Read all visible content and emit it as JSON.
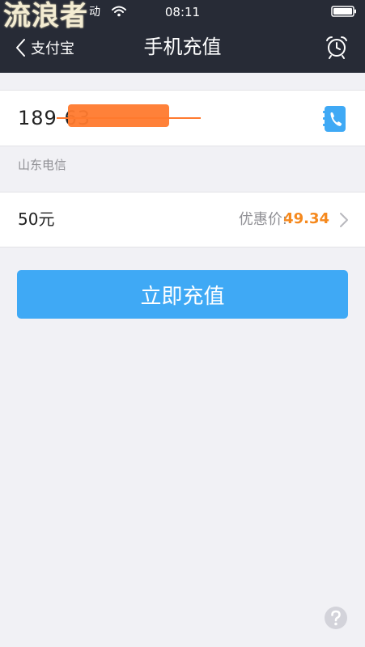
{
  "status_bar": {
    "watermark": "流浪者",
    "carrier_tail": "动",
    "time": "08:11",
    "icons": [
      "wifi-icon",
      "battery-icon"
    ]
  },
  "nav": {
    "back_label": "支付宝",
    "title": "手机充值",
    "icons": [
      "chevron-left-icon",
      "alarm-clock-icon"
    ]
  },
  "phone": {
    "number": "189 63",
    "icon": "contacts-phone-icon",
    "carrier": "山东电信"
  },
  "amount": {
    "value": "50元",
    "discount_label": "优惠价:",
    "discount_price": "49.34",
    "icon": "chevron-right-icon"
  },
  "recharge_button": {
    "label": "立即充值"
  },
  "colors": {
    "header_bg": "#272b36",
    "accent_blue": "#3fa9f5",
    "price_orange": "#f5891e",
    "page_bg": "#f1f1f5",
    "redaction": "#ff7a2e"
  },
  "help": {
    "icon": "help-question-icon"
  }
}
